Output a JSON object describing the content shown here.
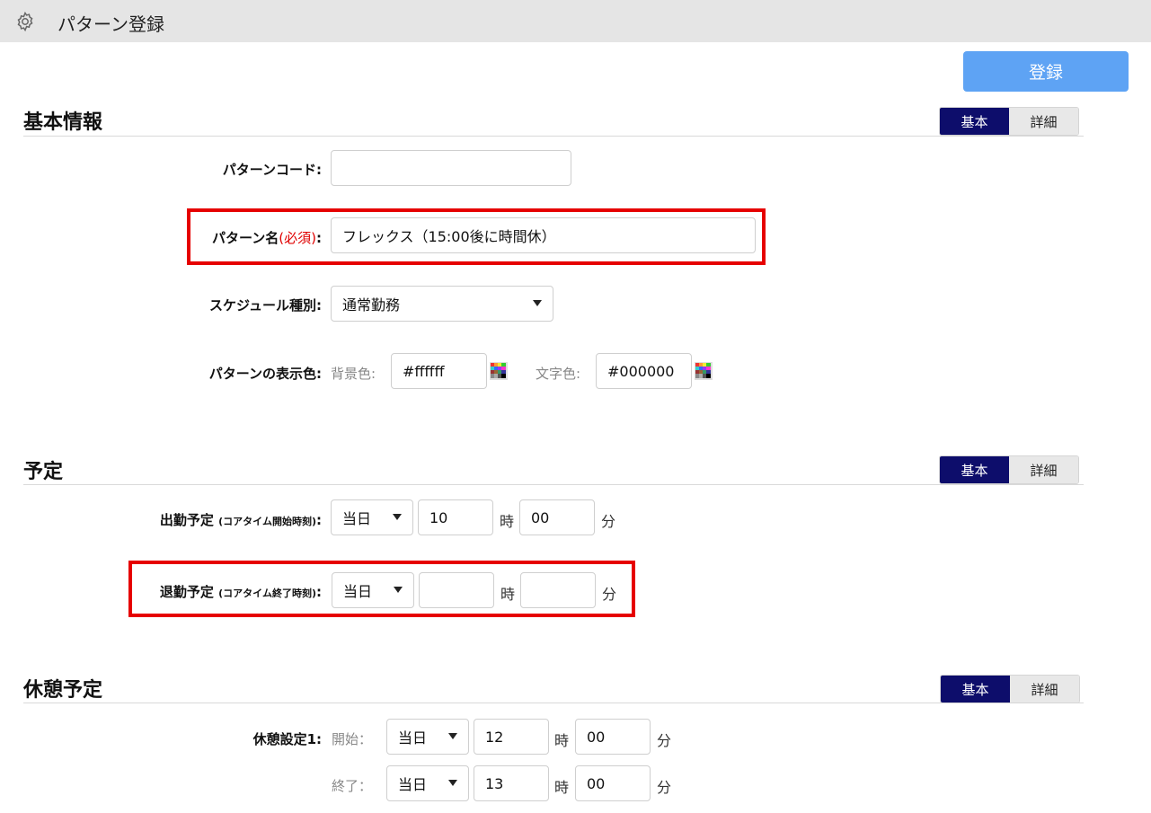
{
  "window": {
    "title": "パターン登録",
    "icon": "gear-icon"
  },
  "toolbar": {
    "register_label": "登録"
  },
  "toggle": {
    "basic": "基本",
    "detail": "詳細"
  },
  "basic_info": {
    "title": "基本情報",
    "pattern_code": {
      "label": "パターンコード:",
      "value": ""
    },
    "pattern_name": {
      "label": "パターン名",
      "required": "(必須)",
      "colon": ":",
      "value": "フレックス（15:00後に時間休）"
    },
    "schedule_type": {
      "label": "スケジュール種別:",
      "value": "通常勤務"
    },
    "display_color": {
      "label": "パターンの表示色:",
      "bg_label": "背景色:",
      "bg_value": "#ffffff",
      "text_label": "文字色:",
      "text_value": "#000000"
    }
  },
  "schedule": {
    "title": "予定",
    "clock_in": {
      "label": "出勤予定",
      "note": "(コアタイム開始時刻)",
      "colon": ":",
      "day": "当日",
      "hour": "10",
      "minute": "00"
    },
    "clock_out": {
      "label": "退勤予定",
      "note": "(コアタイム終了時刻)",
      "colon": ":",
      "day": "当日",
      "hour": "",
      "minute": ""
    }
  },
  "break_schedule": {
    "title": "休憩予定",
    "setting1": {
      "label": "休憩設定1:",
      "start_label": "開始：",
      "start_day": "当日",
      "start_hour": "12",
      "start_minute": "00",
      "end_label": "終了：",
      "end_day": "当日",
      "end_hour": "13",
      "end_minute": "00"
    }
  },
  "units": {
    "hour": "時",
    "minute": "分"
  },
  "colors": {
    "accent_button": "#5ea3f4",
    "toggle_active": "#0d0d6b",
    "highlight": "#e60000",
    "required": "#e00000"
  }
}
